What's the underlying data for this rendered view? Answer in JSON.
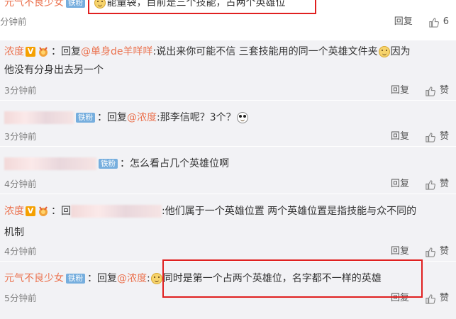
{
  "top": {
    "user": "元气不良少女",
    "fan_badge": "铁粉",
    "text": "能量袋，目前是三个技能，占两个英雄位",
    "time": "分钟前",
    "reply": "回复",
    "likes": "6"
  },
  "comments": [
    {
      "user": "浓度",
      "colon": "：",
      "reply_prefix": "回复",
      "mention": "@单身de羊咩咩",
      "text_a": ":说出来你可能不信 三套技能用的同一个英雄文件夹",
      "text_b": "因为",
      "text_line2": "他没有分身出去另一个",
      "time": "3分钟前",
      "reply": "回复",
      "like": "赞"
    },
    {
      "fan_badge": "铁粉",
      "colon": "：",
      "reply_prefix": "回复",
      "mention": "@浓度",
      "text": ":那李信呢？3个？",
      "time": "3分钟前",
      "reply": "回复",
      "like": "赞"
    },
    {
      "fan_badge": "铁粉",
      "colon": "：",
      "text": "怎么看占几个英雄位啊",
      "time": "4分钟前",
      "reply": "回复",
      "like": "赞"
    },
    {
      "user": "浓度",
      "colon": "：",
      "reply_prefix": "回",
      "text": ":他们属于一个英雄位置 两个英雄位置是指技能与众不同的",
      "text_line2": "机制",
      "time": "4分钟前",
      "reply": "回复",
      "like": "赞"
    },
    {
      "user": "元气不良少女",
      "fan_badge": "铁粉",
      "colon": "：",
      "reply_prefix": "回复",
      "mention": "@浓度",
      "text_a": ":",
      "text_b": "同时是第一个占两个英雄位，名字都不一样的英雄",
      "time": "5分钟前",
      "reply": "回复",
      "like": "赞"
    }
  ],
  "colors": {
    "username": "#eb7350",
    "fan_badge": "#76aede",
    "highlight_box": "#e02020",
    "row_bg": "#f2f2f5"
  }
}
